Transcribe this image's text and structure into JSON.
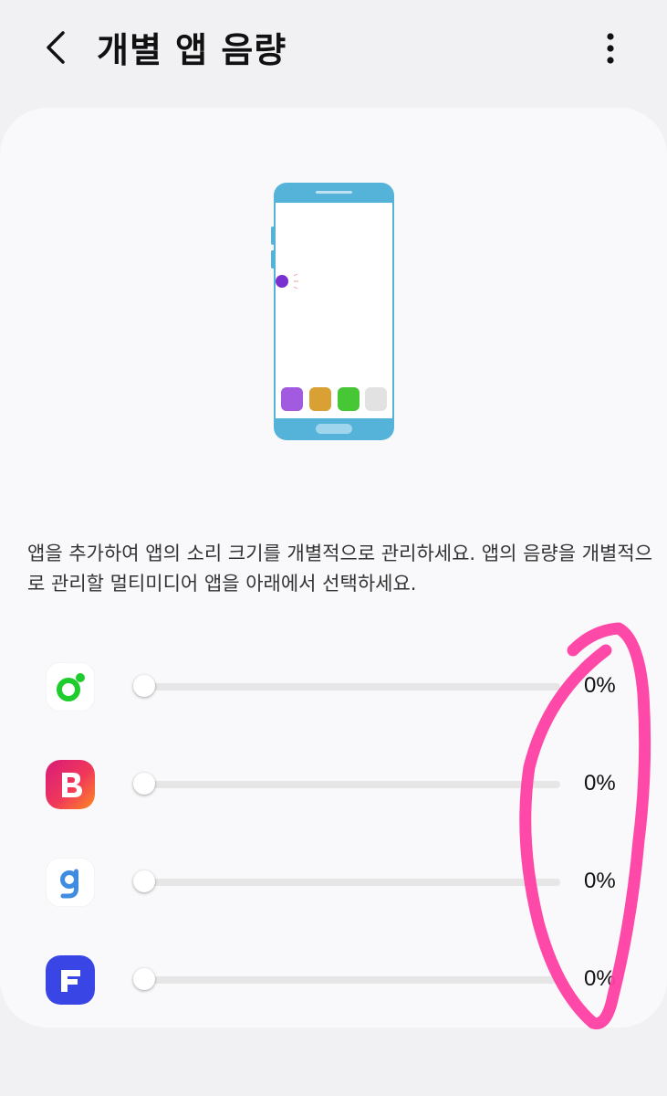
{
  "header": {
    "title": "개별 앱 음량",
    "back_icon": "chevron-left-icon",
    "more_icon": "more-vertical-icon"
  },
  "illustration": {
    "dock_colors": [
      "#a15ae0",
      "#d9a033",
      "#47c636",
      "#e2e2e2"
    ],
    "accent": "#55b3d9"
  },
  "description": "앱을 추가하여 앱의 소리 크기를 개별적으로 관리하세요. 앱의 음량을 개별적으로 관리할 멀티미디어 앱을 아래에서 선택하세요.",
  "apps": [
    {
      "icon": "green-circle-app-icon",
      "volume": 0,
      "percent_label": "0%"
    },
    {
      "icon": "b-letter-app-icon",
      "volume": 0,
      "percent_label": "0%"
    },
    {
      "icon": "g-letter-app-icon",
      "volume": 0,
      "percent_label": "0%"
    },
    {
      "icon": "f-letter-app-icon",
      "volume": 0,
      "percent_label": "0%"
    }
  ],
  "annotation": {
    "color": "#ff3fa4"
  }
}
